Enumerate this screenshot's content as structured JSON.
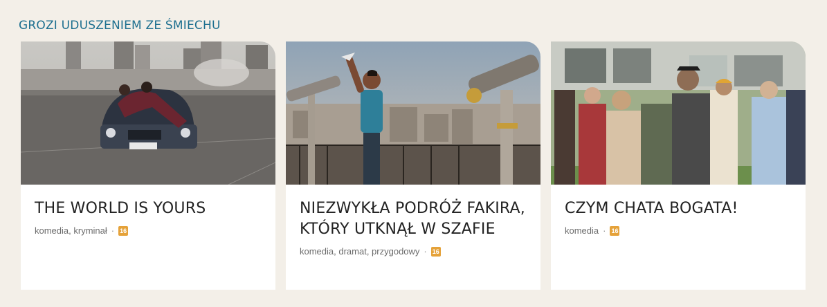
{
  "section": {
    "title": "GROZI UDUSZENIEM ZE ŚMIECHU"
  },
  "colors": {
    "accent": "#1d6f8f",
    "background": "#f3efe8",
    "badge": "#e5a23a"
  },
  "cards": [
    {
      "title": "THE WORLD IS YOURS",
      "genres": "komedia, kryminał",
      "age_rating": "16",
      "image_icon": "movie-still-car-city"
    },
    {
      "title": "NIEZWYKŁA PODRÓŻ FAKIRA, KTÓRY UTKNĄŁ W SZAFIE",
      "genres": "komedia, dramat, przygodowy",
      "age_rating": "16",
      "image_icon": "movie-still-paris-telescopes"
    },
    {
      "title": "CZYM CHATA BOGATA!",
      "genres": "komedia",
      "age_rating": "16",
      "image_icon": "movie-still-party-dance"
    }
  ]
}
